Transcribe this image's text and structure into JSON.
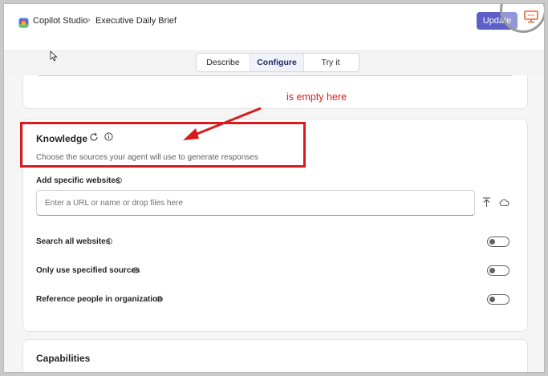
{
  "header": {
    "app_title": "Copilot Studio",
    "breadcrumb_separator": "›",
    "agent_name": "Executive Daily Brief",
    "update_label": "Update"
  },
  "tabs": [
    {
      "label": "Describe",
      "selected": false
    },
    {
      "label": "Configure",
      "selected": true
    },
    {
      "label": "Try it",
      "selected": false
    }
  ],
  "knowledge": {
    "title": "Knowledge",
    "description": "Choose the sources your agent will use to generate responses",
    "add_sites_label": "Add specific websites",
    "url_placeholder": "Enter a URL or name or drop files here",
    "url_value": "",
    "toggles": [
      {
        "label": "Search all websites",
        "on": false
      },
      {
        "label": "Only use specified sources",
        "on": false
      },
      {
        "label": "Reference people in organization",
        "on": false
      }
    ]
  },
  "capabilities": {
    "title": "Capabilities"
  },
  "annotation": {
    "text": "is empty here",
    "color": "#d81b1b"
  },
  "colors": {
    "accent": "#5b5fc7",
    "annotation_red": "#d81b1b"
  }
}
